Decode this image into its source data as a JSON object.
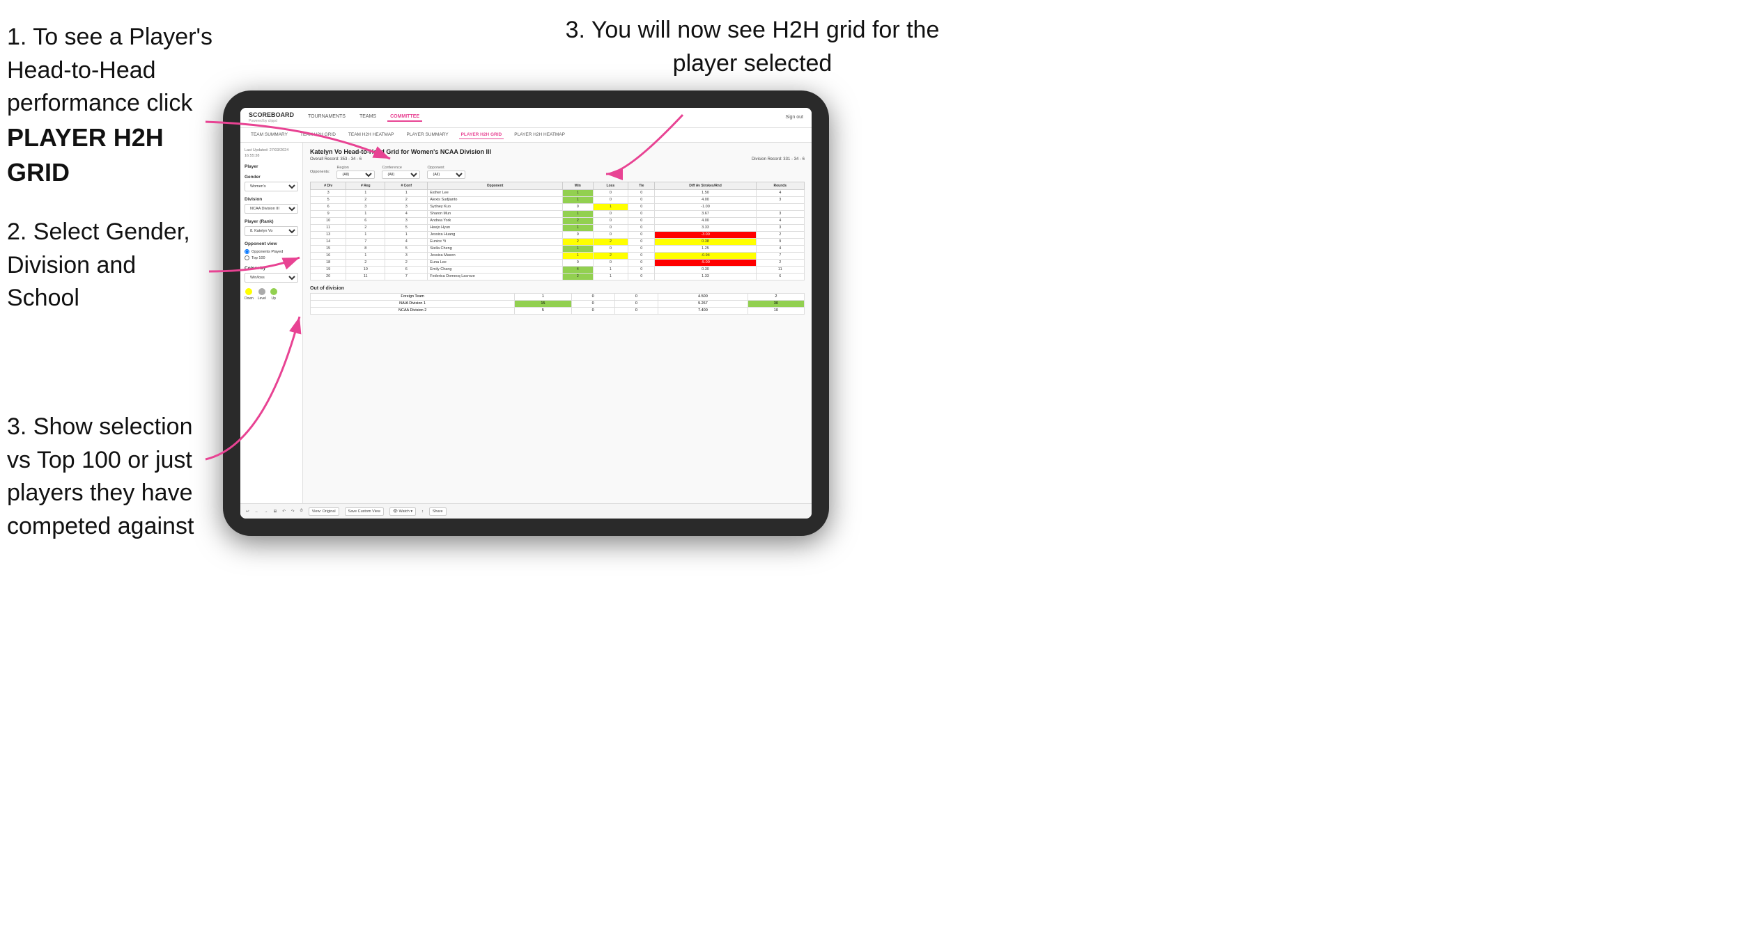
{
  "instructions": {
    "top_right": "3. You will now see H2H grid\nfor the player selected",
    "left_1": "1. To see a Player's Head-to-Head performance click",
    "left_1_bold": "PLAYER H2H GRID",
    "left_2_title": "2. Select Gender,\nDivision and\nSchool",
    "left_3_title": "3. Show selection\nvs Top 100 or just\nplayers they have\ncompeted against"
  },
  "navbar": {
    "brand": "SCOREBOARD",
    "brand_sub": "Powered by clippd",
    "nav_items": [
      "TOURNAMENTS",
      "TEAMS",
      "COMMITTEE"
    ],
    "active_nav": "COMMITTEE",
    "sign_in": "Sign out"
  },
  "subnav": {
    "items": [
      "TEAM SUMMARY",
      "TEAM H2H GRID",
      "TEAM H2H HEATMAP",
      "PLAYER SUMMARY",
      "PLAYER H2H GRID",
      "PLAYER H2H HEATMAP"
    ],
    "active": "PLAYER H2H GRID"
  },
  "sidebar": {
    "timestamp": "Last Updated: 27/03/2024\n16:55:38",
    "player_label": "Player",
    "gender_label": "Gender",
    "gender_value": "Women's",
    "division_label": "Division",
    "division_value": "NCAA Division III",
    "player_rank_label": "Player (Rank)",
    "player_rank_value": "8. Katelyn Vo",
    "opponent_view_label": "Opponent view",
    "radio_opponents": "Opponents Played",
    "radio_top100": "Top 100",
    "colour_by_label": "Colour by",
    "colour_by_value": "Win/loss",
    "legend": [
      {
        "label": "Down",
        "color": "#ffff00"
      },
      {
        "label": "Level",
        "color": "#aaaaaa"
      },
      {
        "label": "Up",
        "color": "#92d050"
      }
    ]
  },
  "main": {
    "title": "Katelyn Vo Head-to-Head Grid for Women's NCAA Division III",
    "overall_record": "Overall Record: 353 - 34 - 6",
    "division_record": "Division Record: 331 - 34 - 6",
    "filters": {
      "opponents_label": "Opponents:",
      "region_label": "Region",
      "region_value": "(All)",
      "conference_label": "Conference",
      "conference_value": "(All)",
      "opponent_label": "Opponent",
      "opponent_value": "(All)"
    },
    "table_headers": [
      "# Div",
      "# Reg",
      "# Conf",
      "Opponent",
      "Win",
      "Loss",
      "Tie",
      "Diff Av Strokes/Rnd",
      "Rounds"
    ],
    "rows": [
      {
        "div": 3,
        "reg": 1,
        "conf": 1,
        "opponent": "Esther Lee",
        "win": 1,
        "loss": 0,
        "tie": 0,
        "diff": 1.5,
        "rounds": 4,
        "win_color": "green"
      },
      {
        "div": 5,
        "reg": 2,
        "conf": 2,
        "opponent": "Alexis Sudjianto",
        "win": 1,
        "loss": 0,
        "tie": 0,
        "diff": 4.0,
        "rounds": 3,
        "win_color": "green"
      },
      {
        "div": 6,
        "reg": 3,
        "conf": 3,
        "opponent": "Sydney Kuo",
        "win": 0,
        "loss": 1,
        "tie": 0,
        "diff": -1.0,
        "rounds": "",
        "win_color": "yellow"
      },
      {
        "div": 9,
        "reg": 1,
        "conf": 4,
        "opponent": "Sharon Mun",
        "win": 1,
        "loss": 0,
        "tie": 0,
        "diff": 3.67,
        "rounds": 3,
        "win_color": "green"
      },
      {
        "div": 10,
        "reg": 6,
        "conf": 3,
        "opponent": "Andrea York",
        "win": 2,
        "loss": 0,
        "tie": 0,
        "diff": 4.0,
        "rounds": 4,
        "win_color": "green"
      },
      {
        "div": 11,
        "reg": 2,
        "conf": 5,
        "opponent": "Heejo Hyun",
        "win": 1,
        "loss": 0,
        "tie": 0,
        "diff": 3.33,
        "rounds": 3,
        "win_color": "green"
      },
      {
        "div": 13,
        "reg": 1,
        "conf": 1,
        "opponent": "Jessica Huang",
        "win": 0,
        "loss": 0,
        "tie": 0,
        "diff": -3.0,
        "rounds": 2,
        "win_color": "red"
      },
      {
        "div": 14,
        "reg": 7,
        "conf": 4,
        "opponent": "Eunice Yi",
        "win": 2,
        "loss": 2,
        "tie": 0,
        "diff": 0.38,
        "rounds": 9,
        "win_color": "yellow"
      },
      {
        "div": 15,
        "reg": 8,
        "conf": 5,
        "opponent": "Stella Cheng",
        "win": 1,
        "loss": 0,
        "tie": 0,
        "diff": 1.25,
        "rounds": 4,
        "win_color": "green"
      },
      {
        "div": 16,
        "reg": 1,
        "conf": 3,
        "opponent": "Jessica Mason",
        "win": 1,
        "loss": 2,
        "tie": 0,
        "diff": -0.94,
        "rounds": 7,
        "win_color": "yellow"
      },
      {
        "div": 18,
        "reg": 2,
        "conf": 2,
        "opponent": "Euna Lee",
        "win": 0,
        "loss": 0,
        "tie": 0,
        "diff": -5.0,
        "rounds": 2,
        "win_color": "red"
      },
      {
        "div": 19,
        "reg": 10,
        "conf": 6,
        "opponent": "Emily Chang",
        "win": 4,
        "loss": 1,
        "tie": 0,
        "diff": 0.3,
        "rounds": 11,
        "win_color": "green"
      },
      {
        "div": 20,
        "reg": 11,
        "conf": 7,
        "opponent": "Federica Domecq Lacroze",
        "win": 2,
        "loss": 1,
        "tie": 0,
        "diff": 1.33,
        "rounds": 6,
        "win_color": "green"
      }
    ],
    "out_of_division_label": "Out of division",
    "out_of_division_rows": [
      {
        "team": "Foreign Team",
        "win": 1,
        "loss": 0,
        "tie": 0,
        "diff": 4.5,
        "rounds": 2
      },
      {
        "team": "NAIA Division 1",
        "win": 15,
        "loss": 0,
        "tie": 0,
        "diff": 9.267,
        "rounds": 30
      },
      {
        "team": "NCAA Division 2",
        "win": 5,
        "loss": 0,
        "tie": 0,
        "diff": 7.4,
        "rounds": 10
      }
    ]
  },
  "toolbar": {
    "buttons": [
      "↩",
      "←",
      "→",
      "⊞",
      "↶",
      "↷",
      "⏱",
      "View: Original",
      "Save Custom View",
      "Watch",
      "⊡",
      "↕",
      "Share"
    ]
  }
}
